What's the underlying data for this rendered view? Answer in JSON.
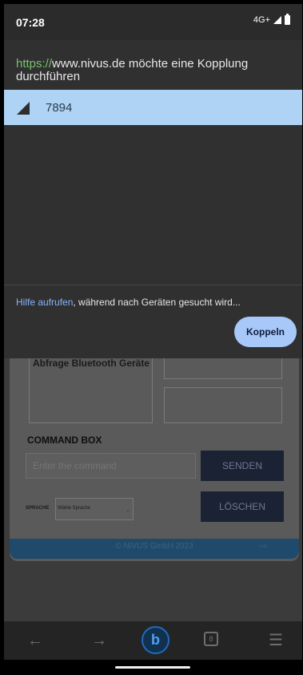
{
  "status_bar": {
    "time": "07:28",
    "network": "4G+"
  },
  "dialog": {
    "origin_protocol": "https://",
    "origin_host": "www.nivus.de",
    "title_suffix": " möchte eine Kopplung durchführen",
    "device_name": "7894",
    "help_link": "Hilfe aufrufen",
    "help_text": ", während nach Geräten gesucht wird...",
    "pair_button": "Koppeln"
  },
  "page": {
    "list_box_text": "Abfrage Bluetooth Geräte",
    "command_title": "COMMAND BOX",
    "command_placeholder": "Enter the command",
    "send_button": "SENDEN",
    "clear_button": "LÖSCHEN",
    "language_label": "SPRACHE",
    "language_select": "Wähle Sprache",
    "footer_text": "© NIVUS GmbH 2023",
    "footer_version": "v142"
  },
  "bottom_nav": {
    "tab_count": "8"
  },
  "icons": [
    "signal-icon",
    "battery-icon",
    "back-icon",
    "forward-icon",
    "bing-icon",
    "tabs-icon",
    "menu-icon"
  ]
}
